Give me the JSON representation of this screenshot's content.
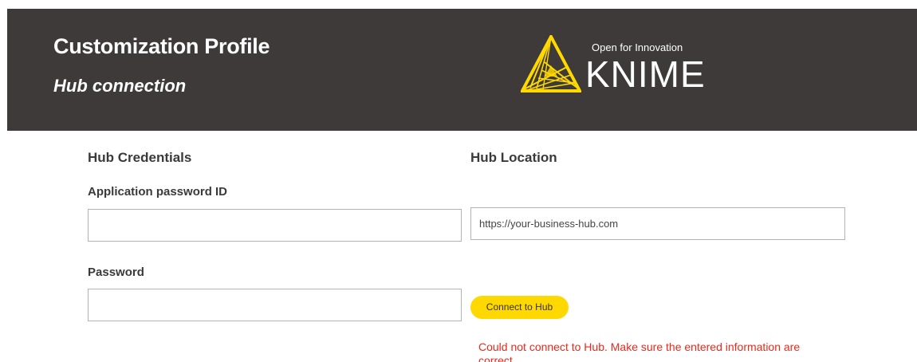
{
  "header": {
    "title": "Customization Profile",
    "subtitle": "Hub connection",
    "background_color": "#3e3a39",
    "logo": {
      "tagline": "Open for Innovation",
      "wordmark": "KNIME",
      "accent_color": "#ffd800",
      "icon": "knime-triangle-logo-icon"
    }
  },
  "credentials": {
    "section_title": "Hub Credentials",
    "app_password_id": {
      "label": "Application password ID",
      "value": "",
      "placeholder": ""
    },
    "password": {
      "label": "Password",
      "value": "",
      "placeholder": ""
    }
  },
  "location": {
    "section_title": "Hub Location",
    "url": {
      "value": "",
      "placeholder": "https://your-business-hub.com"
    }
  },
  "actions": {
    "connect_label": "Connect to Hub",
    "button_color": "#ffd800"
  },
  "status": {
    "error_message": "Could not connect to Hub. Make sure the entered information are correct",
    "error_color": "#e8291c"
  }
}
